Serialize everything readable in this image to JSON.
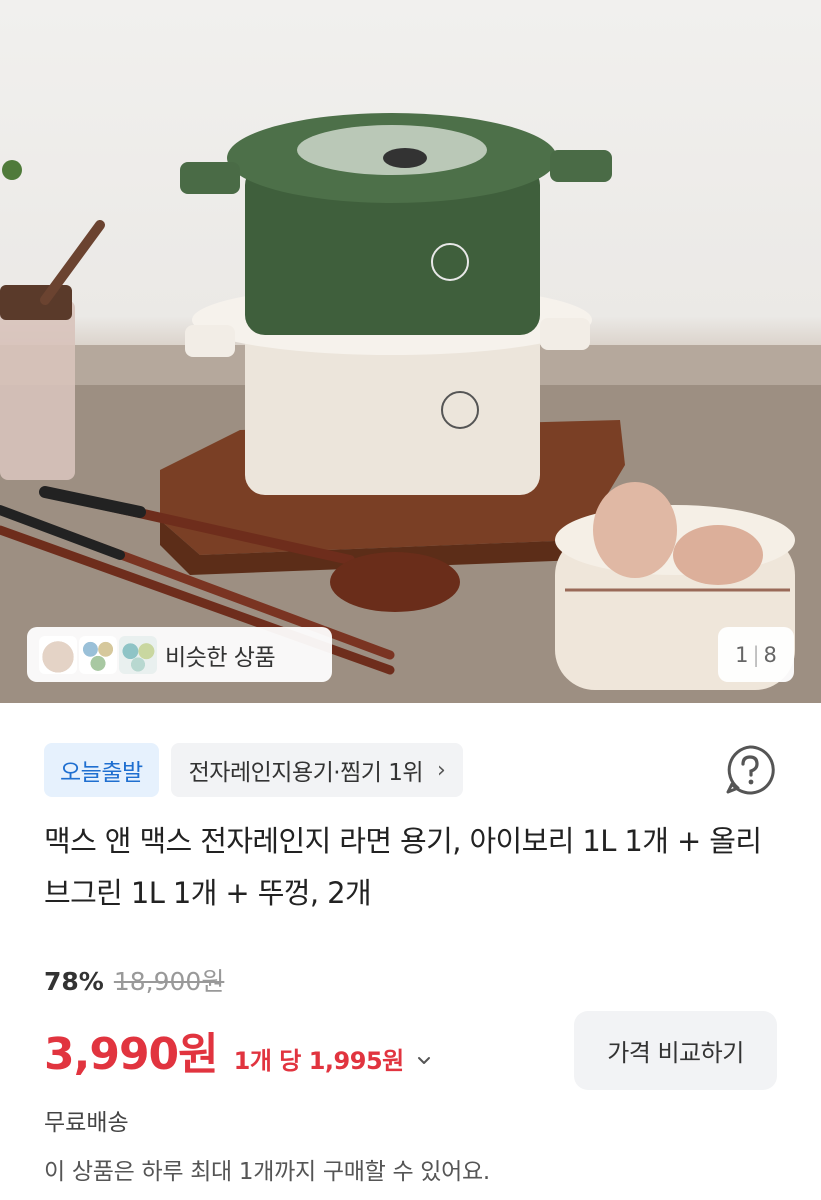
{
  "hero": {
    "product_image": "microwave ramen containers product photo",
    "similar_label": "비슷한 상품",
    "counter_current": "1",
    "counter_separator": "|",
    "counter_total": "8"
  },
  "badges": {
    "today": "오늘출발",
    "rank": "전자레인지용기·찜기 1위",
    "rank_icon": "chevron-right-icon"
  },
  "help_icon": "question-circle-icon",
  "product": {
    "title": "맥스 앤 맥스 전자레인지 라면 용기, 아이보리 1L 1개 + 올리브그린 1L 1개 + 뚜껑, 2개"
  },
  "pricing": {
    "discount": "78%",
    "original_price": "18,900원",
    "price": "3,990원",
    "unit_price": "1개 당 1,995원",
    "compare_button": "가격 비교하기",
    "accent_color": "#e1343f"
  },
  "shipping": "무료배송",
  "purchase_limit": "이 상품은 하루 최대 1개까지 구매할 수 있어요."
}
